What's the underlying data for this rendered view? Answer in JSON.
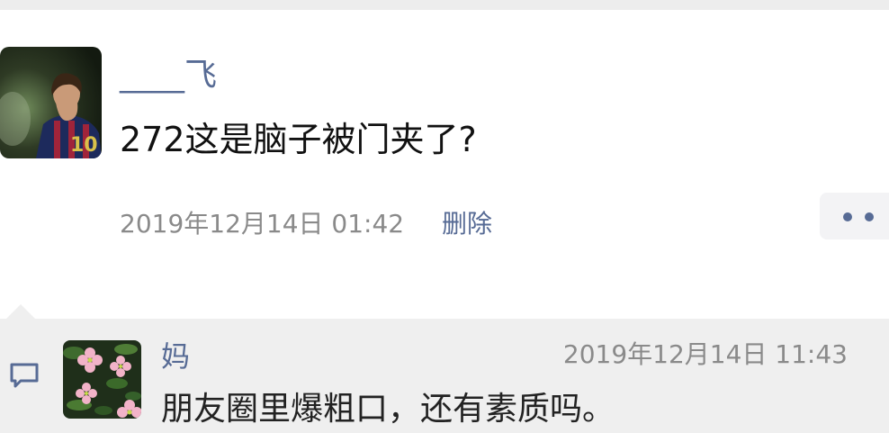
{
  "post": {
    "author": "____飞",
    "text": "272这是脑子被门夹了?",
    "time": "2019年12月14日 01:42",
    "delete_label": "删除",
    "more_icon": "more-dots-icon"
  },
  "comment": {
    "icon": "comment-icon",
    "author": "妈",
    "time": "2019年12月14日 11:43",
    "text": "朋友圈里爆粗口，还有素质吗。"
  },
  "colors": {
    "link": "#576b95",
    "meta": "#8a8a8a",
    "comment_bg": "#efefef",
    "top_bar": "#ededed"
  }
}
